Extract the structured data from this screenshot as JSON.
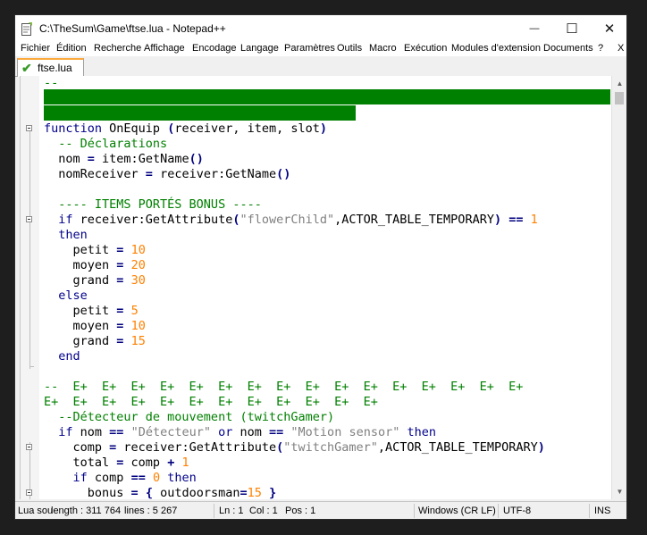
{
  "window": {
    "title": "C:\\TheSum\\Game\\ftse.lua - Notepad++"
  },
  "controls": {
    "minimize": "—",
    "maximize": "☐",
    "close": "✕"
  },
  "menu": [
    "Fichier",
    "Édition",
    "Recherche",
    "Affichage",
    "Encodage",
    "Langage",
    "Paramètres",
    "Outils",
    "Macro",
    "Exécution",
    "Modules d'extension",
    "Documents",
    "?",
    "X"
  ],
  "tab": {
    "label": "ftse.lua",
    "icon": "saved-check-icon"
  },
  "code_lines": [
    [
      {
        "t": "--",
        "c": "cm"
      }
    ],
    [],
    [],
    [
      {
        "t": "function",
        "c": "kw"
      },
      {
        "t": " OnEquip ",
        "c": "id"
      },
      {
        "t": "(",
        "c": "op"
      },
      {
        "t": "receiver, item, slot",
        "c": "id"
      },
      {
        "t": ")",
        "c": "op"
      }
    ],
    [
      {
        "t": "  -- Déclarations",
        "c": "cm"
      }
    ],
    [
      {
        "t": "  nom ",
        "c": "id"
      },
      {
        "t": "=",
        "c": "op"
      },
      {
        "t": " item:GetName",
        "c": "id"
      },
      {
        "t": "()",
        "c": "op"
      }
    ],
    [
      {
        "t": "  nomReceiver ",
        "c": "id"
      },
      {
        "t": "=",
        "c": "op"
      },
      {
        "t": " receiver:GetName",
        "c": "id"
      },
      {
        "t": "()",
        "c": "op"
      }
    ],
    [],
    [
      {
        "t": "  ---- ITEMS PORTÉS BONUS ----",
        "c": "cm"
      }
    ],
    [
      {
        "t": "  if",
        "c": "kw"
      },
      {
        "t": " receiver:GetAttribute",
        "c": "id"
      },
      {
        "t": "(",
        "c": "op"
      },
      {
        "t": "\"flowerChild\"",
        "c": "str"
      },
      {
        "t": ",ACTOR_TABLE_TEMPORARY",
        "c": "id"
      },
      {
        "t": ")",
        "c": "op"
      },
      {
        "t": " ",
        "c": "id"
      },
      {
        "t": "==",
        "c": "op"
      },
      {
        "t": " ",
        "c": "id"
      },
      {
        "t": "1",
        "c": "num"
      }
    ],
    [
      {
        "t": "  then",
        "c": "kw"
      }
    ],
    [
      {
        "t": "    petit ",
        "c": "id"
      },
      {
        "t": "=",
        "c": "op"
      },
      {
        "t": " ",
        "c": "id"
      },
      {
        "t": "10",
        "c": "num"
      }
    ],
    [
      {
        "t": "    moyen ",
        "c": "id"
      },
      {
        "t": "=",
        "c": "op"
      },
      {
        "t": " ",
        "c": "id"
      },
      {
        "t": "20",
        "c": "num"
      }
    ],
    [
      {
        "t": "    grand ",
        "c": "id"
      },
      {
        "t": "=",
        "c": "op"
      },
      {
        "t": " ",
        "c": "id"
      },
      {
        "t": "30",
        "c": "num"
      }
    ],
    [
      {
        "t": "  else",
        "c": "kw"
      }
    ],
    [
      {
        "t": "    petit ",
        "c": "id"
      },
      {
        "t": "=",
        "c": "op"
      },
      {
        "t": " ",
        "c": "id"
      },
      {
        "t": "5",
        "c": "num"
      }
    ],
    [
      {
        "t": "    moyen ",
        "c": "id"
      },
      {
        "t": "=",
        "c": "op"
      },
      {
        "t": " ",
        "c": "id"
      },
      {
        "t": "10",
        "c": "num"
      }
    ],
    [
      {
        "t": "    grand ",
        "c": "id"
      },
      {
        "t": "=",
        "c": "op"
      },
      {
        "t": " ",
        "c": "id"
      },
      {
        "t": "15",
        "c": "num"
      }
    ],
    [
      {
        "t": "  end",
        "c": "kw"
      }
    ],
    [],
    [
      {
        "t": "--  E+  E+  E+  E+  E+  E+  E+  E+  E+  E+  E+  E+  E+  E+  E+  E+",
        "c": "cm"
      }
    ],
    [
      {
        "t": "E+  E+  E+  E+  E+  E+  E+  E+  E+  E+  E+  E+",
        "c": "cm"
      }
    ],
    [
      {
        "t": "  --Détecteur de mouvement (twitchGamer)",
        "c": "cm"
      }
    ],
    [
      {
        "t": "  if",
        "c": "kw"
      },
      {
        "t": " nom ",
        "c": "id"
      },
      {
        "t": "==",
        "c": "op"
      },
      {
        "t": " ",
        "c": "id"
      },
      {
        "t": "\"Détecteur\"",
        "c": "str"
      },
      {
        "t": " ",
        "c": "id"
      },
      {
        "t": "or",
        "c": "kw"
      },
      {
        "t": " nom ",
        "c": "id"
      },
      {
        "t": "==",
        "c": "op"
      },
      {
        "t": " ",
        "c": "id"
      },
      {
        "t": "\"Motion sensor\"",
        "c": "str"
      },
      {
        "t": " ",
        "c": "id"
      },
      {
        "t": "then",
        "c": "kw"
      }
    ],
    [
      {
        "t": "    comp ",
        "c": "id"
      },
      {
        "t": "=",
        "c": "op"
      },
      {
        "t": " receiver:GetAttribute",
        "c": "id"
      },
      {
        "t": "(",
        "c": "op"
      },
      {
        "t": "\"twitchGamer\"",
        "c": "str"
      },
      {
        "t": ",ACTOR_TABLE_TEMPORARY",
        "c": "id"
      },
      {
        "t": ")",
        "c": "op"
      }
    ],
    [
      {
        "t": "    total ",
        "c": "id"
      },
      {
        "t": "=",
        "c": "op"
      },
      {
        "t": " comp ",
        "c": "id"
      },
      {
        "t": "+",
        "c": "op"
      },
      {
        "t": " ",
        "c": "id"
      },
      {
        "t": "1",
        "c": "num"
      }
    ],
    [
      {
        "t": "    if",
        "c": "kw"
      },
      {
        "t": " comp ",
        "c": "id"
      },
      {
        "t": "==",
        "c": "op"
      },
      {
        "t": " ",
        "c": "id"
      },
      {
        "t": "0",
        "c": "num"
      },
      {
        "t": " ",
        "c": "id"
      },
      {
        "t": "then",
        "c": "kw"
      }
    ],
    [
      {
        "t": "      bonus ",
        "c": "id"
      },
      {
        "t": "=",
        "c": "op"
      },
      {
        "t": " ",
        "c": "id"
      },
      {
        "t": "{",
        "c": "op"
      },
      {
        "t": " outdoorsman",
        "c": "id"
      },
      {
        "t": "=",
        "c": "op"
      },
      {
        "t": "15",
        "c": "num"
      },
      {
        "t": " ",
        "c": "id"
      },
      {
        "t": "}",
        "c": "op"
      }
    ]
  ],
  "status": {
    "file_type": "Lua sou",
    "length": "length : 311 764",
    "lines": "lines : 5 267",
    "ln": "Ln : 1",
    "col": "Col : 1",
    "pos": "Pos : 1",
    "eol": "Windows (CR LF)",
    "encoding": "UTF-8",
    "mode": "INS"
  },
  "colors": {
    "highlight": "#008000",
    "keyword": "#00008b",
    "comment": "#008000",
    "string": "#808080",
    "number": "#ff8000",
    "tab_accent": "#fcaa3e"
  }
}
